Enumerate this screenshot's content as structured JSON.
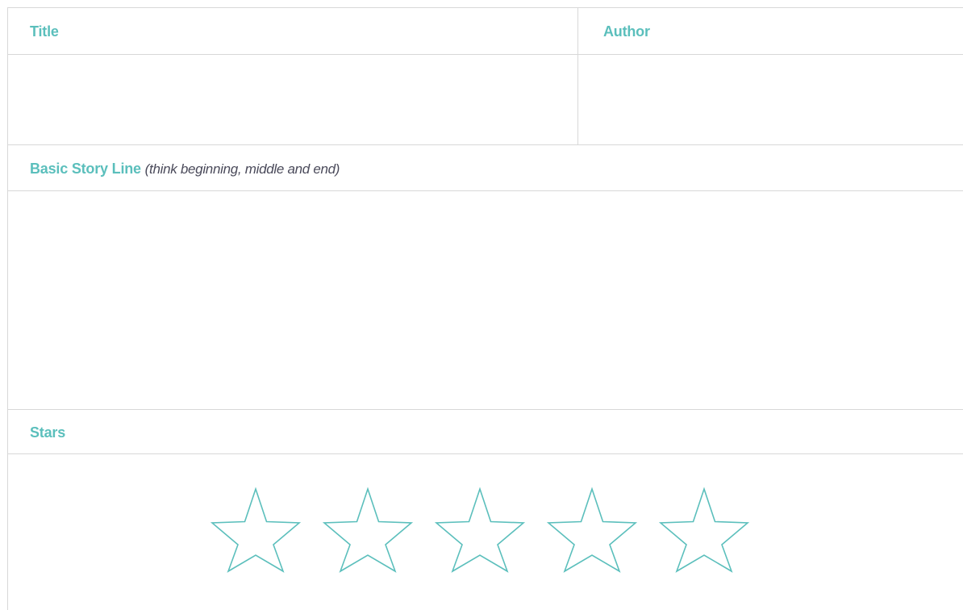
{
  "header": {
    "title_label": "Title",
    "author_label": "Author"
  },
  "story": {
    "label": "Basic Story Line",
    "hint": "(think beginning, middle and end)"
  },
  "stars": {
    "label": "Stars",
    "count": 5,
    "rating": 0
  },
  "colors": {
    "accent": "#5bbfbc",
    "hint_text": "#4a4a5a",
    "border": "#d8d8d8"
  }
}
